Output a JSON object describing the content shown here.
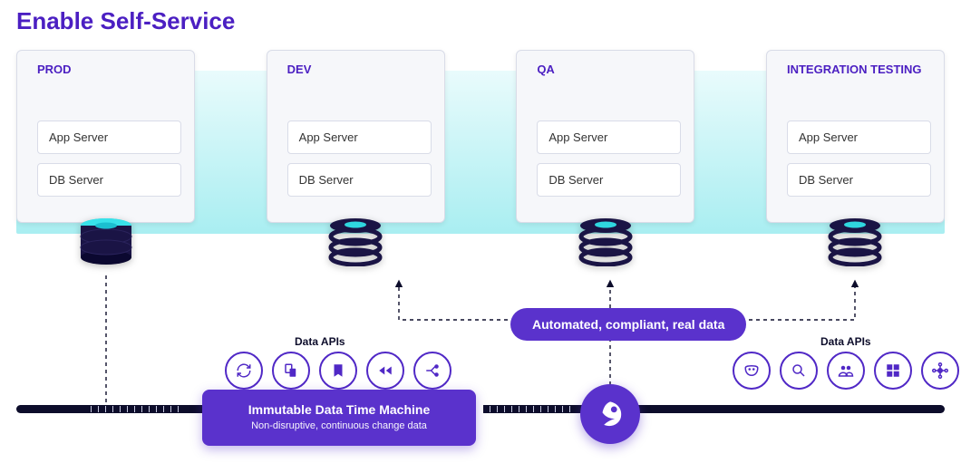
{
  "title": "Enable Self-Service",
  "environments": [
    {
      "id": "prod",
      "title": "PROD",
      "boxes": [
        "App Server",
        "DB Server"
      ],
      "db_style": "solid"
    },
    {
      "id": "dev",
      "title": "DEV",
      "boxes": [
        "App Server",
        "DB Server"
      ],
      "db_style": "virtual"
    },
    {
      "id": "qa",
      "title": "QA",
      "boxes": [
        "App Server",
        "DB Server"
      ],
      "db_style": "virtual"
    },
    {
      "id": "int",
      "title": "INTEGRATION TESTING",
      "boxes": [
        "App Server",
        "DB Server"
      ],
      "db_style": "virtual"
    }
  ],
  "api_groups": [
    {
      "id": "left",
      "label": "Data APIs",
      "icons": [
        "refresh-icon",
        "copy-icon",
        "bookmark-icon",
        "rewind-icon",
        "branch-icon"
      ]
    },
    {
      "id": "right",
      "label": "Data APIs",
      "icons": [
        "mask-icon",
        "search-icon",
        "users-icon",
        "grid-icon",
        "integrations-icon"
      ]
    }
  ],
  "central_pill": "Automated, compliant, real data",
  "time_machine": {
    "title": "Immutable Data Time Machine",
    "subtitle": "Non-disruptive, continuous change data"
  },
  "brand": "delphix-logo",
  "colors": {
    "purple": "#5028c6",
    "cyan": "#54e6e6",
    "dark_navy": "#0d0d2b"
  }
}
